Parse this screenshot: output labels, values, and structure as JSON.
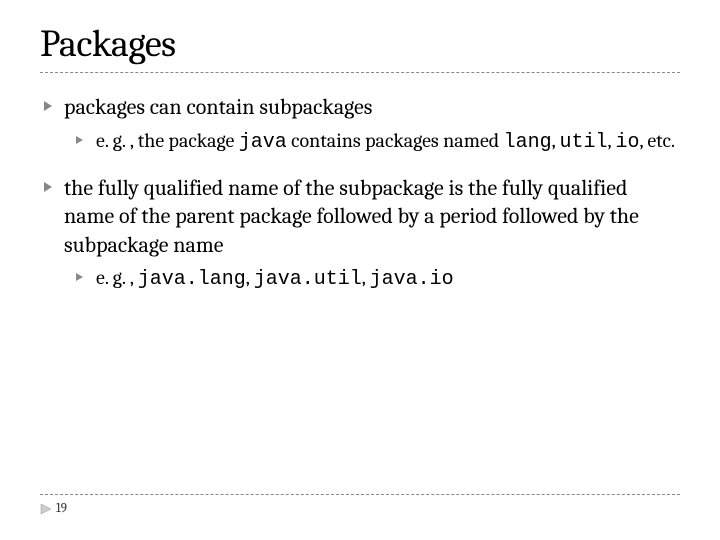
{
  "title": "Packages",
  "bullets": [
    {
      "text_parts": [
        "packages can contain subpackages"
      ],
      "sub": [
        {
          "text_parts": [
            "e. g. , the package ",
            {
              "mono": "java"
            },
            " contains packages named ",
            {
              "mono": "lang"
            },
            ", ",
            {
              "mono": "util"
            },
            ", ",
            {
              "mono": "io"
            },
            ", etc."
          ]
        }
      ]
    },
    {
      "text_parts": [
        "the fully qualified name of the subpackage is the fully qualified name of the parent package followed by a period followed by the subpackage name"
      ],
      "sub": [
        {
          "text_parts": [
            "e. g. , ",
            {
              "mono": "java.lang"
            },
            ", ",
            {
              "mono": "java.util"
            },
            ", ",
            {
              "mono": "java.io"
            }
          ]
        }
      ]
    }
  ],
  "page_number": "19"
}
